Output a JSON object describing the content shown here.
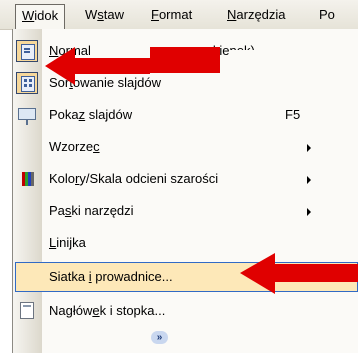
{
  "menubar": {
    "items": [
      {
        "label": "Widok",
        "mnemonic": "W",
        "rest": "idok"
      },
      {
        "label": "Wstaw",
        "pre": "W",
        "mnemonic": "s",
        "rest": "taw"
      },
      {
        "label": "Format",
        "mnemonic": "F",
        "rest": "ormat"
      },
      {
        "label": "Narzędzia",
        "mnemonic": "N",
        "rest": "arzędzia"
      },
      {
        "label": "Po"
      }
    ]
  },
  "dropdown": {
    "items": [
      {
        "label_pre": "",
        "label_mn": "N",
        "label_post": "ormal",
        "label_hidden": "(przywróć okienek)",
        "label_tail": "kienek)",
        "icon": "normal-view-icon",
        "checked": true
      },
      {
        "label_pre": "Sor",
        "label_mn": "t",
        "label_post": "owanie slajdów",
        "icon": "slide-sorter-icon",
        "checked": true
      },
      {
        "label_pre": "Poka",
        "label_mn": "z",
        "label_post": " slajdów",
        "shortcut": "F5",
        "icon": "slide-show-icon"
      },
      {
        "label_pre": "Wzorze",
        "label_mn": "c",
        "label_post": "",
        "submenu": true
      },
      {
        "label_pre": "Kolo",
        "label_mn": "r",
        "label_post": "y/Skala odcieni szarości",
        "icon": "color-grayscale-icon",
        "submenu": true
      },
      {
        "label_pre": "Pa",
        "label_mn": "s",
        "label_post": "ki narzędzi",
        "submenu": true
      },
      {
        "label_pre": "",
        "label_mn": "L",
        "label_post": "inijka"
      },
      {
        "label_pre": "Siatka ",
        "label_mn": "i",
        "label_post": " prowadnice...",
        "highlighted": true
      },
      {
        "label_pre": "Nagłów",
        "label_mn": "e",
        "label_post": "k i stopka...",
        "icon": "header-footer-icon"
      }
    ],
    "expand_icon": "expand-chevron-icon",
    "expand_glyph": "»"
  },
  "annotations": {
    "arrow_color": "#e00000"
  }
}
